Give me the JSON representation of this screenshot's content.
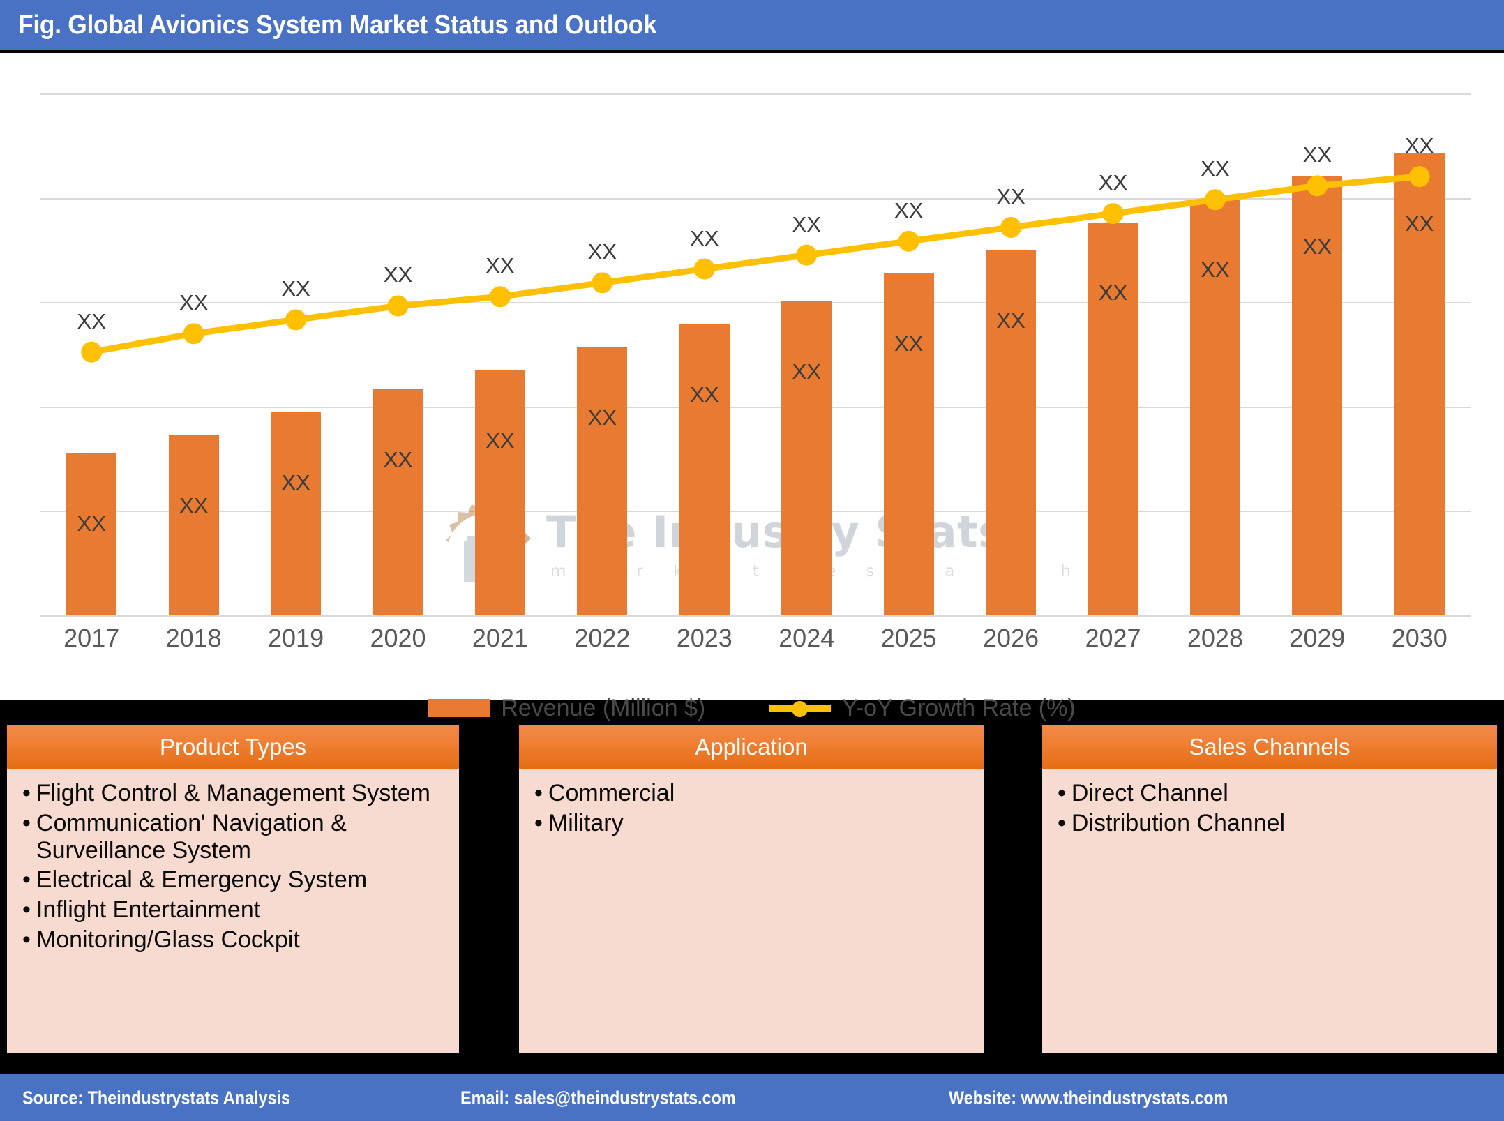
{
  "header": {
    "title": "Fig. Global Avionics System Market Status and Outlook",
    "bar_color": "#4A72C4"
  },
  "chart_data": {
    "type": "bar",
    "title": "Fig. Global Avionics System Market Status and Outlook",
    "xlabel": "",
    "ylabel": "",
    "grid": true,
    "legend_position": "bottom",
    "categories": [
      "2017",
      "2018",
      "2019",
      "2020",
      "2021",
      "2022",
      "2023",
      "2024",
      "2025",
      "2026",
      "2027",
      "2028",
      "2029",
      "2030"
    ],
    "series": [
      {
        "name": "Revenue (Million $)",
        "type": "bar",
        "color": "#E87B31",
        "values": [
          35,
          39,
          44,
          49,
          53,
          58,
          63,
          68,
          74,
          79,
          85,
          90,
          95,
          100
        ],
        "value_labels": [
          "XX",
          "XX",
          "XX",
          "XX",
          "XX",
          "XX",
          "XX",
          "XX",
          "XX",
          "XX",
          "XX",
          "XX",
          "XX",
          "XX"
        ]
      },
      {
        "name": "Y-oY Growth Rate (%)",
        "type": "line",
        "color": "#FFC000",
        "values": [
          57,
          61,
          64,
          67,
          69,
          72,
          75,
          78,
          81,
          84,
          87,
          90,
          93,
          95
        ],
        "value_labels": [
          "XX",
          "XX",
          "XX",
          "XX",
          "XX",
          "XX",
          "XX",
          "XX",
          "XX",
          "XX",
          "XX",
          "XX",
          "XX",
          "XX"
        ]
      }
    ],
    "legend": [
      {
        "label": "Revenue (Million $)",
        "marker": "bar",
        "color": "#E87B31"
      },
      {
        "label": "Y-oY Growth Rate (%)",
        "marker": "line-dot",
        "color": "#FFC000"
      }
    ]
  },
  "watermark": {
    "text": "The Industry Stats",
    "subtitle": "m a r k e t   r e s e a r c h"
  },
  "boxes": [
    {
      "header": "Product Types",
      "items": [
        "Flight Control & Management System",
        "Communication' Navigation & Surveillance System",
        "Electrical & Emergency System",
        "Inflight Entertainment",
        "Monitoring/Glass Cockpit"
      ]
    },
    {
      "header": "Application",
      "items": [
        "Commercial",
        "Military"
      ]
    },
    {
      "header": "Sales Channels",
      "items": [
        "Direct Channel",
        "Distribution Channel"
      ]
    }
  ],
  "footer": {
    "source": "Source: Theindustrystats Analysis",
    "email": "Email: sales@theindustrystats.com",
    "website": "Website: www.theindustrystats.com",
    "bar_color": "#4A72C4"
  }
}
